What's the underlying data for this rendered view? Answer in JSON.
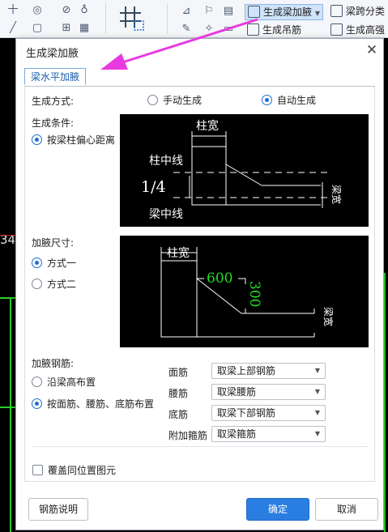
{
  "toolbar": {
    "btn_gen_haunch": "生成梁加腋",
    "btn_span": "梁跨分类",
    "btn_hanger": "生成吊筋",
    "btn_cut": "生成高强",
    "left_glyphs": [
      "十",
      "◎",
      "⊘",
      "♁",
      "╱",
      "▢",
      "⊞",
      "▦"
    ]
  },
  "canvas": {
    "number_fragment": "34("
  },
  "dialog": {
    "title": "生成梁加腋",
    "tab_label": "梁水平加腋",
    "gen_mode": {
      "label": "生成方式:",
      "manual": "手动生成",
      "auto": "自动生成",
      "selected": "auto"
    },
    "gen_cond": {
      "label": "生成条件:",
      "option": "按梁柱偏心距离"
    },
    "diagram1": {
      "col_width": "柱宽",
      "col_centerline": "柱中线",
      "fraction": "1/4",
      "beam_centerline": "梁中线",
      "beam_width": "梁宽"
    },
    "haunch_size": {
      "label": "加腋尺寸:",
      "opt1": "方式一",
      "opt2": "方式二",
      "selected": "opt1"
    },
    "diagram2": {
      "col_width": "柱宽",
      "dim_h": "600",
      "dim_v": "300",
      "beam_width": "梁宽"
    },
    "haunch_rebar": {
      "label": "加腋钢筋:",
      "opt1": "沿梁高布置",
      "opt2": "按面筋、腰筋、底筋布置",
      "selected": "opt2"
    },
    "rebars": [
      {
        "label": "面筋",
        "value": "取梁上部钢筋"
      },
      {
        "label": "腰筋",
        "value": "取梁腰筋"
      },
      {
        "label": "底筋",
        "value": "取梁下部钢筋"
      },
      {
        "label": "附加箍筋",
        "value": "取梁箍筋"
      }
    ],
    "overwrite": "覆盖同位置图元",
    "btn_help": "钢筋说明",
    "btn_ok": "确定",
    "btn_cancel": "取消"
  },
  "colors": {
    "accent": "#2a7de1",
    "annotation_arrow": "#e83ae0",
    "diagram_bg": "#000000",
    "diagram_line": "#ffffff",
    "dimension_text": "#22dd22"
  }
}
